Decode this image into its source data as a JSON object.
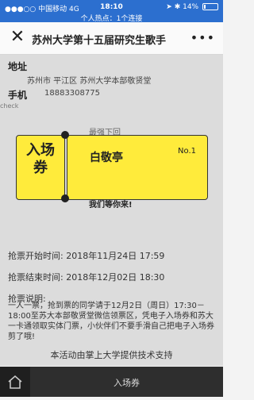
{
  "status_bar": {
    "carrier": "中国移动",
    "network": "4G",
    "time": "18:10",
    "battery": "14%",
    "battery_level": 0.14,
    "hotspot": "个人热点：1个连接"
  },
  "nav": {
    "title": "苏州大学第十五届研究生歌手",
    "close_icon": "close-icon",
    "more_icon": "more-dots-icon"
  },
  "info": {
    "address_label": "地址",
    "address_value": "苏州市 平江区 苏州大学本部敬贤堂",
    "phone_label": "手机",
    "phone_value": "18883308775",
    "check_text": "check"
  },
  "ticket": {
    "behind_top": "最强下回",
    "stub_text": "入场券",
    "venue": "白敬亭",
    "number": "No.1",
    "behind_bottom": "我们等你来!",
    "color": "#ffeb3b"
  },
  "details": {
    "start_label": "抢票开始时间:",
    "start_value": "2018年11月24日 17:59",
    "end_label": "抢票结束时间:",
    "end_value": "2018年12月02日 18:30",
    "note_label": "抢票说明:",
    "note_text": "一人一票，抢到票的同学请于12月2日（周日）17:30－18:00至苏大本部敬贤堂微信领票区，凭电子入场券和苏大一卡通领取实体门票，小伙伴们不要手滑自己把电子入场券剪了哦!"
  },
  "footer": {
    "tech_support": "本活动由掌上大学提供技术支持"
  },
  "tabbar": {
    "home_icon": "home-icon",
    "ticket_tab": "入场券"
  }
}
